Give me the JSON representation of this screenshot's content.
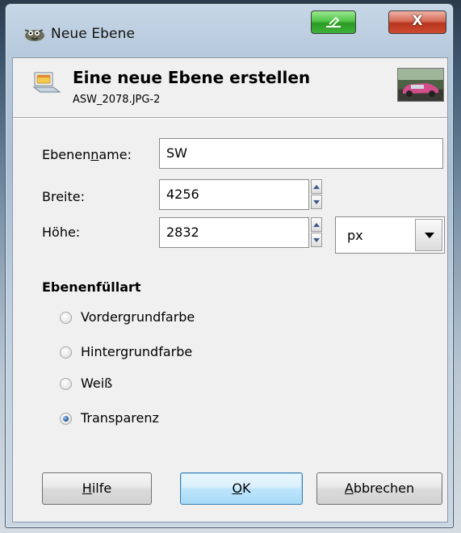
{
  "window": {
    "title": "Neue Ebene",
    "minimize_icon": "minimize-icon",
    "close_icon": "close-icon",
    "close_glyph": "X"
  },
  "header": {
    "title": "Eine neue Ebene erstellen",
    "subtitle": "ASW_2078.JPG-2",
    "icon": "new-layer-icon",
    "thumbnail": "image-thumbnail"
  },
  "form": {
    "name_label_pre": "Ebenen",
    "name_label_mn": "n",
    "name_label_post": "ame:",
    "name_value": "SW",
    "width_label": "Breite:",
    "width_value": "4256",
    "height_label": "Höhe:",
    "height_value": "2832",
    "unit_value": "px"
  },
  "fill": {
    "title": "Ebenenfüllart",
    "options": [
      {
        "label": "Vordergrundfarbe",
        "checked": false
      },
      {
        "label": "Hintergrundfarbe",
        "checked": false
      },
      {
        "label": "Weiß",
        "checked": false
      },
      {
        "label": "Transparenz",
        "checked": true
      }
    ]
  },
  "buttons": {
    "help_mn": "H",
    "help_rest": "ilfe",
    "ok_mn": "O",
    "ok_rest": "K",
    "cancel_mn": "A",
    "cancel_rest": "bbrechen"
  }
}
